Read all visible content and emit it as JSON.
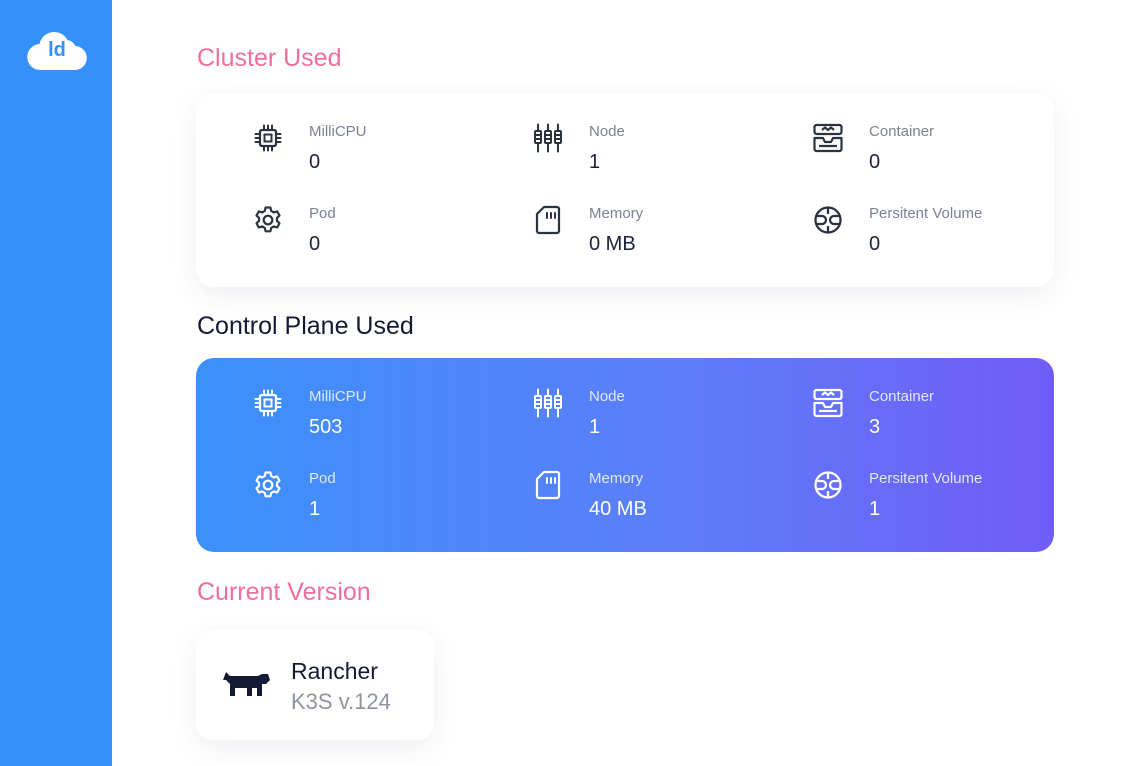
{
  "logo": {
    "text": "ld"
  },
  "sections": {
    "cluster": {
      "title": "Cluster Used",
      "stats": [
        {
          "icon": "cpu-icon",
          "label": "MilliCPU",
          "value": "0"
        },
        {
          "icon": "node-icon",
          "label": "Node",
          "value": "1"
        },
        {
          "icon": "container-icon",
          "label": "Container",
          "value": "0"
        },
        {
          "icon": "gear-icon",
          "label": "Pod",
          "value": "0"
        },
        {
          "icon": "memory-card-icon",
          "label": "Memory",
          "value": "0 MB"
        },
        {
          "icon": "volume-icon",
          "label": "Persitent Volume",
          "value": "0"
        }
      ]
    },
    "control_plane": {
      "title": "Control Plane Used",
      "stats": [
        {
          "icon": "cpu-icon",
          "label": "MilliCPU",
          "value": "503"
        },
        {
          "icon": "node-icon",
          "label": "Node",
          "value": "1"
        },
        {
          "icon": "container-icon",
          "label": "Container",
          "value": "3"
        },
        {
          "icon": "gear-icon",
          "label": "Pod",
          "value": "1"
        },
        {
          "icon": "memory-card-icon",
          "label": "Memory",
          "value": "40 MB"
        },
        {
          "icon": "volume-icon",
          "label": "Persitent Volume",
          "value": "1"
        }
      ]
    },
    "version": {
      "title": "Current Version",
      "name": "Rancher",
      "version": "K3S v.124",
      "icon": "rancher-logo-icon"
    }
  },
  "colors": {
    "sidebar": "#3590f9",
    "accent_pink": "#f06da0",
    "gradient_start": "#3b91f9",
    "gradient_end": "#715cf8"
  }
}
